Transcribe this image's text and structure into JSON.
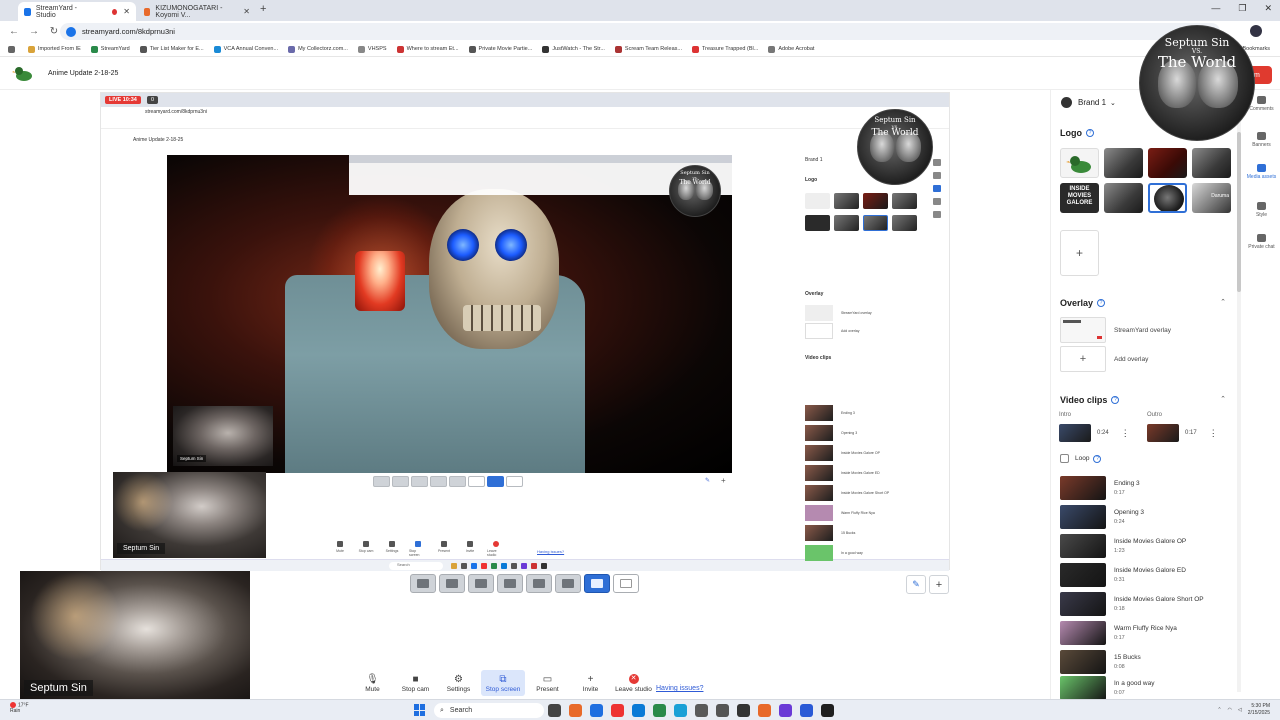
{
  "browser": {
    "tabs": [
      {
        "label": "StreamYard - Studio",
        "active": true
      },
      {
        "label": "KIZUMONOGATARI -Koyomi V...",
        "active": false
      }
    ],
    "url": "streamyard.com/8kdprnu3ni",
    "bookmarks": [
      "Imported From IE",
      "StreamYard",
      "Tier List Maker for E...",
      "VCA Annual Conven...",
      "My Collectorz.com...",
      "VHSPS",
      "Where to stream Et...",
      "Private Movie Partie...",
      "JustWatch - The Str...",
      "Scream Team Releas...",
      "Treasure Trapped (Bl...",
      "Adobe Acrobat"
    ],
    "bookmarks_right": "Bookmarks"
  },
  "header": {
    "title": "Anime Update 2-18-25"
  },
  "nested": {
    "live": "LIVE 10:34",
    "viewers": "0",
    "url": "streamyard.com/8kdprnu3ni",
    "title": "Anime Update 2-18-25",
    "brand": "Brand 1",
    "logo": "Logo",
    "overlay": "Overlay",
    "overlay_item": "StreamYard overlay",
    "add_overlay": "Add overlay",
    "video_clips": "Video clips",
    "clips": [
      "Ending 3",
      "Opening 3",
      "Inside Movies Galore OP",
      "Inside Movies Galore ED",
      "Inside Movies Galore Short OP",
      "Warm Fluffy Rice Nya",
      "15 Bucks",
      "In a good way"
    ],
    "cam_name": "Septum Sin",
    "having_issues": "Having issues?",
    "search": "Search",
    "controls": [
      "Mute",
      "Stop cam",
      "Settings",
      "Stop screen",
      "Present",
      "Invite",
      "Leave studio"
    ]
  },
  "badge": {
    "line1": "Septum Sin",
    "line2": "VS.",
    "line3": "The World"
  },
  "cams": [
    {
      "name": "Septum Sin"
    },
    {
      "name": "Septum Sin"
    }
  ],
  "controls": [
    {
      "label": "Mute",
      "icon": "🎙"
    },
    {
      "label": "Stop cam",
      "icon": "■"
    },
    {
      "label": "Settings",
      "icon": "⚙"
    },
    {
      "label": "Stop screen",
      "icon": "⧉"
    },
    {
      "label": "Present",
      "icon": "▭"
    },
    {
      "label": "Invite",
      "icon": "+"
    },
    {
      "label": "Leave studio",
      "icon": "✕"
    }
  ],
  "having_issues": "Having issues?",
  "panel": {
    "brand": "Brand 1",
    "logo_title": "Logo",
    "logo_text_tile": "INSIDE MOVIES GALORE",
    "logo_text_tile2": "Daruma",
    "overlay_title": "Overlay",
    "overlay_item": "StreamYard overlay",
    "add_overlay": "Add overlay",
    "video_clips_title": "Video clips",
    "intro_label": "Intro",
    "outro_label": "Outro",
    "intro_dur": "0:24",
    "outro_dur": "0:17",
    "loop_label": "Loop",
    "clips": [
      {
        "name": "Ending 3",
        "dur": "0:17",
        "color": "#7a3a2a"
      },
      {
        "name": "Opening 3",
        "dur": "0:24",
        "color": "#3a4a6a"
      },
      {
        "name": "Inside Movies Galore OP",
        "dur": "1:23",
        "color": "#4a4a4a"
      },
      {
        "name": "Inside Movies Galore ED",
        "dur": "0:31",
        "color": "#2a2a2a"
      },
      {
        "name": "Inside Movies Galore Short OP",
        "dur": "0:18",
        "color": "#3a3a4a"
      },
      {
        "name": "Warm Fluffy Rice Nya",
        "dur": "0:17",
        "color": "#b58ab0"
      },
      {
        "name": "15 Bucks",
        "dur": "0:08",
        "color": "#5a4a3a"
      },
      {
        "name": "In a good way",
        "dur": "0:07",
        "color": "#6ac46a"
      }
    ]
  },
  "iconbar": [
    {
      "label": "Comments"
    },
    {
      "label": "Banners"
    },
    {
      "label": "Media assets",
      "selected": true
    },
    {
      "label": "Style"
    },
    {
      "label": "Private chat"
    }
  ],
  "sy_button": "om",
  "taskbar": {
    "weather_temp": "17°F",
    "weather_desc": "Rain",
    "search": "Search",
    "time": "5:30 PM",
    "date": "2/15/2025"
  },
  "colors": {
    "accent": "#2f6fd6",
    "live_red": "#e53935",
    "panel_bg": "#ffffff"
  }
}
